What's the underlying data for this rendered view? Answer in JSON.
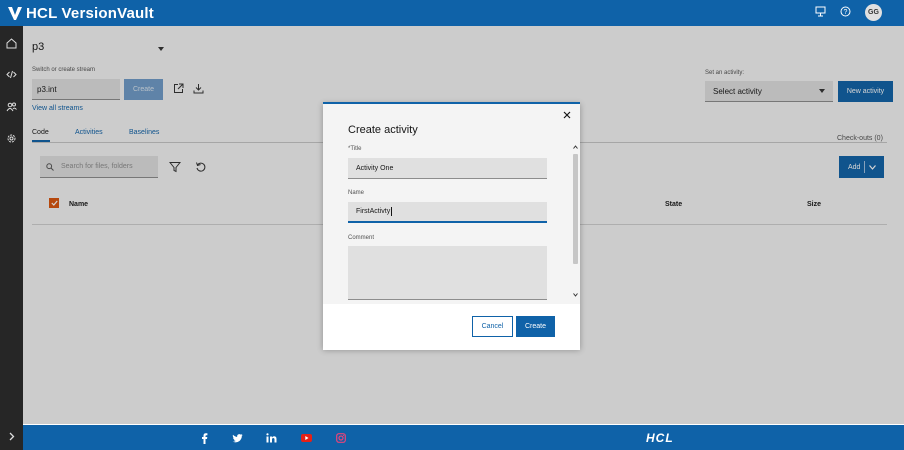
{
  "app": {
    "title": "HCL VersionVault",
    "user_initials": "GG"
  },
  "header_icons": [
    "monitor-icon",
    "help-icon"
  ],
  "sidebar": {
    "items": [
      "home-icon",
      "code-icon",
      "users-icon",
      "settings-icon"
    ],
    "expand": "chevron-right-icon"
  },
  "project": {
    "name": "p3"
  },
  "stream": {
    "label": "Switch or create stream",
    "value": "p3.int",
    "create_label": "Create",
    "view_all": "View all streams"
  },
  "activity": {
    "label": "Set an activity:",
    "select_value": "Select activity",
    "new_label": "New activity"
  },
  "tabs": [
    {
      "label": "Code",
      "active": true
    },
    {
      "label": "Activities",
      "active": false
    },
    {
      "label": "Baselines",
      "active": false
    }
  ],
  "checkouts": "Check-outs (0)",
  "search": {
    "placeholder": "Search for files, folders"
  },
  "add_label": "Add",
  "table": {
    "columns": [
      "Name",
      "State",
      "Size"
    ]
  },
  "dialog": {
    "title": "Create activity",
    "title_label": "*Title",
    "title_value": "Activity One",
    "name_label": "Name",
    "name_value": "FirstActivty",
    "comment_label": "Comment",
    "comment_value": "",
    "cancel_label": "Cancel",
    "create_label": "Create"
  },
  "footer": {
    "social": [
      "facebook-icon",
      "twitter-icon",
      "linkedin-icon",
      "youtube-icon",
      "instagram-icon"
    ],
    "brand": "HCL"
  },
  "colors": {
    "brand": "#0f62a8",
    "nav": "#262626",
    "accent": "#d9540c"
  }
}
